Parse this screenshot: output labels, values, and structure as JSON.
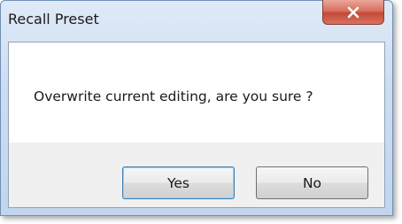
{
  "dialog": {
    "title": "Recall Preset",
    "message": "Overwrite current editing, are you sure ?",
    "buttons": {
      "yes_label": "Yes",
      "no_label": "No"
    },
    "close_icon": "close-icon"
  },
  "colors": {
    "title_bar": "#cddcf0",
    "close_button": "#c94f3d",
    "message_background": "#ffffff",
    "button_area_background": "#f0f0f0"
  }
}
